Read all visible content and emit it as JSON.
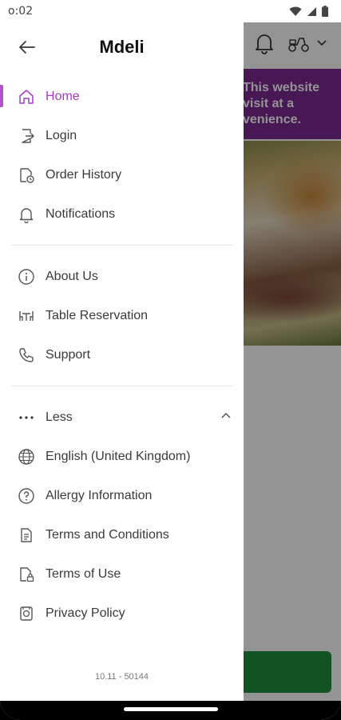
{
  "status_bar": {
    "time": "o:02"
  },
  "background": {
    "banner_lines": [
      "This website",
      "visit at a",
      "venience."
    ]
  },
  "drawer": {
    "title": "Mdeli",
    "section1": [
      {
        "label": "Home",
        "icon": "home-icon",
        "active": true
      },
      {
        "label": "Login",
        "icon": "login-icon"
      },
      {
        "label": "Order History",
        "icon": "order-history-icon"
      },
      {
        "label": "Notifications",
        "icon": "bell-icon"
      }
    ],
    "section2": [
      {
        "label": "About Us",
        "icon": "info-icon"
      },
      {
        "label": "Table Reservation",
        "icon": "table-icon"
      },
      {
        "label": "Support",
        "icon": "phone-icon"
      }
    ],
    "less_label": "Less",
    "section3": [
      {
        "label": "English (United Kingdom)",
        "icon": "globe-icon"
      },
      {
        "label": "Allergy Information",
        "icon": "question-icon"
      },
      {
        "label": "Terms and Conditions",
        "icon": "document-icon"
      },
      {
        "label": "Terms of Use",
        "icon": "document-lock-icon"
      },
      {
        "label": "Privacy Policy",
        "icon": "privacy-icon"
      }
    ],
    "version": "10.11 - 50144"
  },
  "colors": {
    "accent": "#a63cc2",
    "banner": "#7a2a92",
    "cta": "#1f8f3a"
  }
}
